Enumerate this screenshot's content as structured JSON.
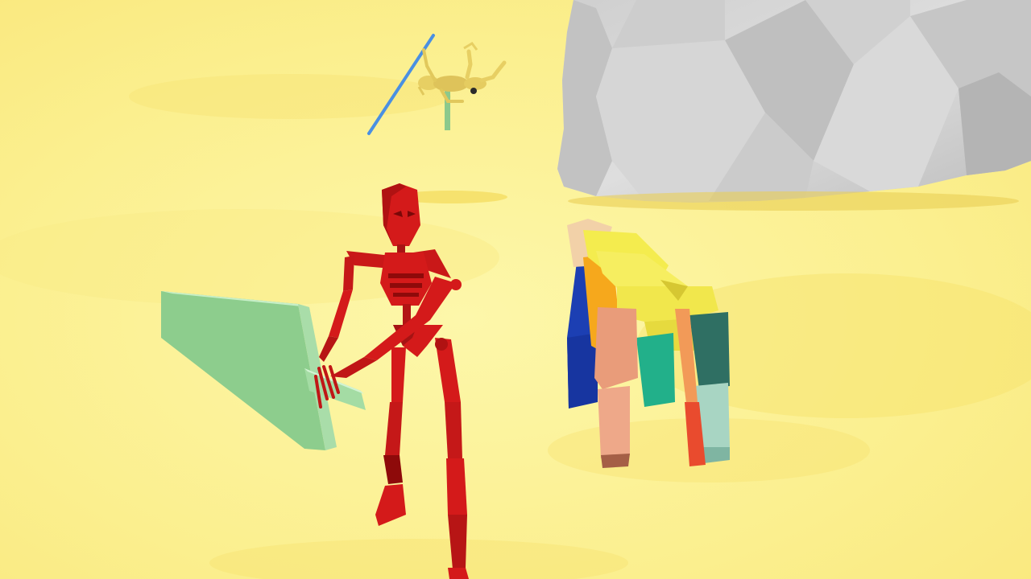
{
  "scene": {
    "name": "desert-arena-3d-viewport",
    "colors": {
      "sand_light": "#FCF5A4",
      "sand_mid": "#FBEC86",
      "sand_shadow": "#F5DC5C",
      "rock_light": "#E2E2E2",
      "rock_mid": "#C9C9C9",
      "rock_dark": "#A6A6A6",
      "skeleton_red": "#D41A1A",
      "skeleton_red_dark": "#8E0A0A",
      "sword_green": "#8DCD8D",
      "sword_green_light": "#B9E9B9",
      "spear_blue": "#4A90E2",
      "distant_skeleton_yellow": "#E7CF63"
    }
  },
  "entities": [
    {
      "id": "red-skeleton-warrior",
      "label": "",
      "color": "#D41A1A"
    },
    {
      "id": "green-greatsword",
      "label": "",
      "color": "#8DCD8D"
    },
    {
      "id": "blocky-colorful-creature",
      "label": "",
      "colors": [
        "#1C3FB3",
        "#F6A81C",
        "#F4EC4E",
        "#E99C7A",
        "#22B08A",
        "#2F6F63",
        "#E94B2E",
        "#A8D5C3"
      ]
    },
    {
      "id": "distant-yellow-skeleton",
      "label": "",
      "color": "#E7CF63"
    },
    {
      "id": "blue-spear",
      "label": "",
      "color": "#4A90E2"
    },
    {
      "id": "gray-boulder",
      "label": "",
      "color": "#C9C9C9"
    }
  ]
}
